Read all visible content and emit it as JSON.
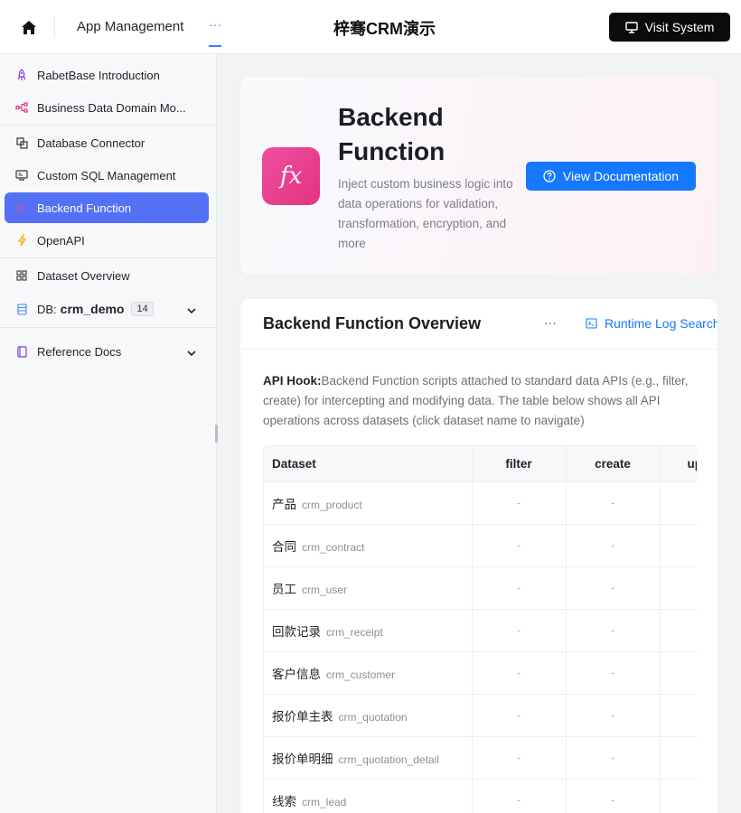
{
  "header": {
    "nav_label": "App Management",
    "more_label": "···",
    "app_title": "梓骞CRM演示",
    "visit_label": "Visit System"
  },
  "sidebar": {
    "items": [
      {
        "label": "RabetBase Introduction",
        "icon": "rocket-icon"
      },
      {
        "label": "Business Data Domain Mo...",
        "icon": "network-icon"
      },
      {
        "label": "Database Connector",
        "icon": "connector-icon"
      },
      {
        "label": "Custom SQL Management",
        "icon": "sql-icon"
      },
      {
        "label": "Backend Function",
        "icon": "fx-icon",
        "active": true
      },
      {
        "label": "OpenAPI",
        "icon": "lightning-icon"
      },
      {
        "label": "Dataset Overview",
        "icon": "grid-icon"
      },
      {
        "label": "Reference Docs",
        "icon": "book-icon"
      }
    ],
    "db": {
      "prefix": "DB:",
      "name": "crm_demo",
      "count": "14"
    }
  },
  "hero": {
    "icon_text": "fx",
    "title": "Backend Function",
    "description": "Inject custom business logic into data operations for validation, transformation, encryption, and more",
    "doc_button": "View Documentation"
  },
  "overview": {
    "title": "Backend Function Overview",
    "dots": "···",
    "log_link": "Runtime Log Search",
    "hook_label": "API Hook:",
    "hook_text": "Backend Function scripts attached to standard data APIs (e.g., filter, create) for intercepting and modifying data. The table below shows all API operations across datasets (click dataset name to navigate)"
  },
  "table": {
    "columns": [
      "Dataset",
      "filter",
      "create",
      "up"
    ],
    "rows": [
      {
        "name": "产品",
        "code": "crm_product",
        "filter": "-",
        "create": "-"
      },
      {
        "name": "合同",
        "code": "crm_contract",
        "filter": "-",
        "create": "-"
      },
      {
        "name": "员工",
        "code": "crm_user",
        "filter": "-",
        "create": "-"
      },
      {
        "name": "回款记录",
        "code": "crm_receipt",
        "filter": "-",
        "create": "-"
      },
      {
        "name": "客户信息",
        "code": "crm_customer",
        "filter": "-",
        "create": "-"
      },
      {
        "name": "报价单主表",
        "code": "crm_quotation",
        "filter": "-",
        "create": "-"
      },
      {
        "name": "报价单明细",
        "code": "crm_quotation_detail",
        "filter": "-",
        "create": "-"
      },
      {
        "name": "线索",
        "code": "crm_lead",
        "filter": "-",
        "create": "-"
      }
    ]
  },
  "colors": {
    "accent": "#1677ff",
    "active_nav": "#5470f5",
    "fx_tile": "#e83f8f"
  }
}
